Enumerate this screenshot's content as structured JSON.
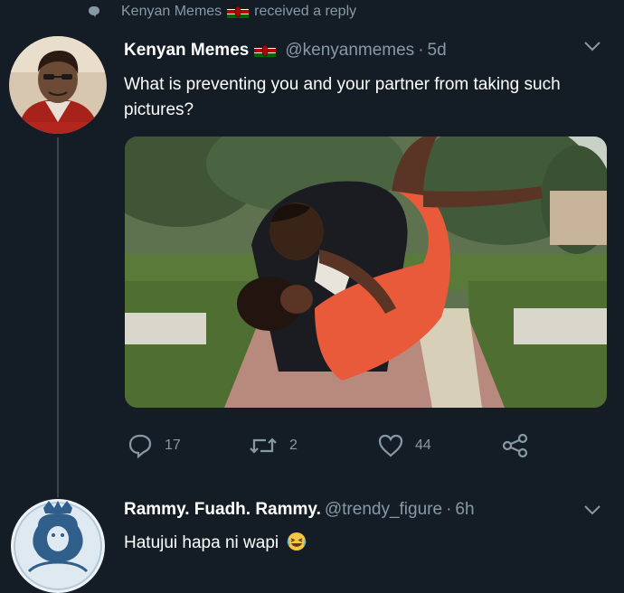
{
  "context": {
    "name": "Kenyan Memes",
    "action": "received a reply"
  },
  "tweet": {
    "name": "Kenyan Memes",
    "handle": "@kenyanmemes",
    "separator": "·",
    "time": "5d",
    "text": "What is preventing you and your partner from taking such pictures?",
    "reply_count": "17",
    "retweet_count": "2",
    "like_count": "44"
  },
  "reply": {
    "name": "Rammy. Fuadh. Rammy.",
    "handle": "@trendy_figure",
    "separator": "·",
    "time": "6h",
    "text": "Hatujui hapa ni wapi"
  },
  "colors": {
    "background": "#141d26",
    "secondary_text": "#8899a6",
    "thread_line": "#38444d"
  }
}
